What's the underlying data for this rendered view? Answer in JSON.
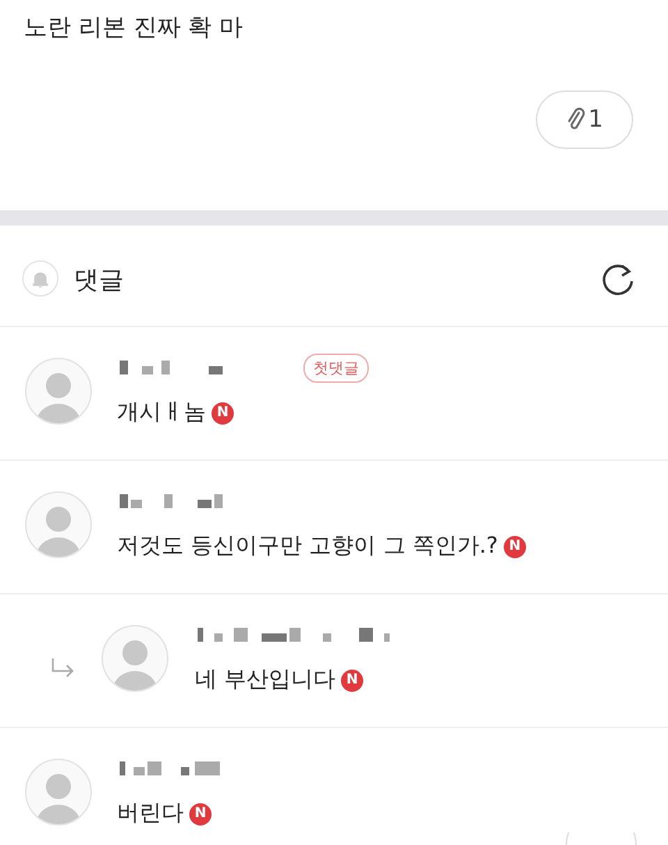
{
  "post": {
    "body": "노란 리본 진짜 확 마",
    "attachment": {
      "count": "1"
    }
  },
  "comments_header": {
    "title": "댓글"
  },
  "comments": [
    {
      "kind": "comment",
      "tag": "첫댓글",
      "text": "개시ㅐ놈",
      "new_mark": "N"
    },
    {
      "kind": "comment",
      "text": "저것도 등신이구만 고향이 그 쪽인가.?",
      "new_mark": "N"
    },
    {
      "kind": "reply",
      "text": "네 부산입니다",
      "new_mark": "N"
    },
    {
      "kind": "comment",
      "text": "버린다",
      "new_mark": "N"
    }
  ]
}
